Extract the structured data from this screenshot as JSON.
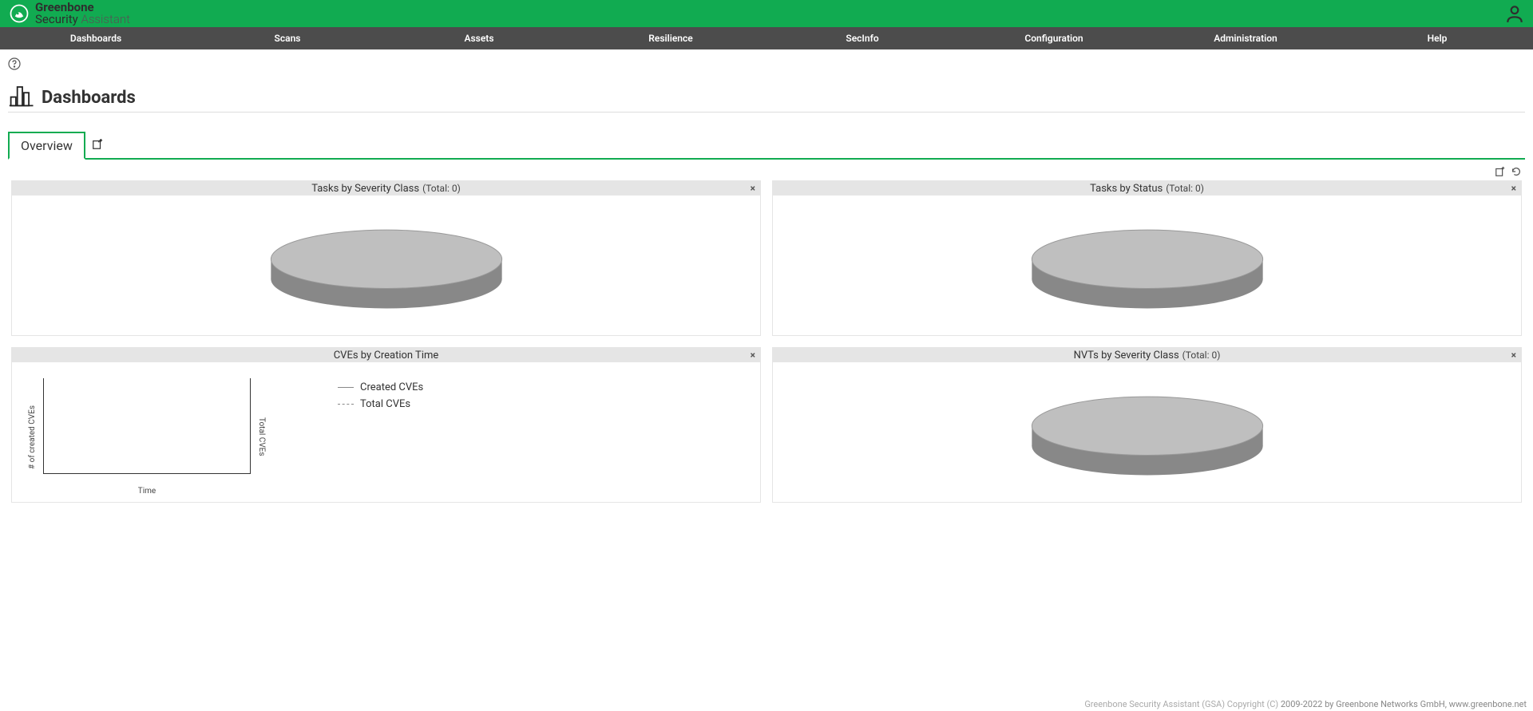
{
  "brand": {
    "line1": "Greenbone",
    "line2_a": "Security",
    "line2_b": "Assistant"
  },
  "nav": {
    "items": [
      "Dashboards",
      "Scans",
      "Assets",
      "Resilience",
      "SecInfo",
      "Configuration",
      "Administration",
      "Help"
    ]
  },
  "page": {
    "title": "Dashboards"
  },
  "tabs": {
    "items": [
      {
        "label": "Overview",
        "active": true
      }
    ]
  },
  "widgets": {
    "tasks_severity": {
      "title": "Tasks by Severity Class",
      "total_label": "(Total: 0)"
    },
    "tasks_status": {
      "title": "Tasks by Status",
      "total_label": "(Total: 0)"
    },
    "cves_time": {
      "title": "CVEs by Creation Time",
      "ylabel_left": "# of created CVEs",
      "ylabel_right": "Total CVEs",
      "xlabel": "Time",
      "legend": {
        "created": "Created CVEs",
        "total": "Total CVEs"
      }
    },
    "nvts_severity": {
      "title": "NVTs by Severity Class",
      "total_label": "(Total: 0)"
    }
  },
  "chart_data": [
    {
      "type": "pie",
      "title": "Tasks by Severity Class",
      "total": 0,
      "categories": [],
      "values": []
    },
    {
      "type": "pie",
      "title": "Tasks by Status",
      "total": 0,
      "categories": [],
      "values": []
    },
    {
      "type": "line",
      "title": "CVEs by Creation Time",
      "xlabel": "Time",
      "ylabel_left": "# of created CVEs",
      "ylabel_right": "Total CVEs",
      "series": [
        {
          "name": "Created CVEs",
          "x": [],
          "values": []
        },
        {
          "name": "Total CVEs",
          "x": [],
          "values": []
        }
      ]
    },
    {
      "type": "pie",
      "title": "NVTs by Severity Class",
      "total": 0,
      "categories": [],
      "values": []
    }
  ],
  "footer": {
    "text_a": "Greenbone Security Assistant (GSA) Copyright (C)",
    "text_b": "2009-2022 by Greenbone Networks GmbH, www.greenbone.net"
  }
}
